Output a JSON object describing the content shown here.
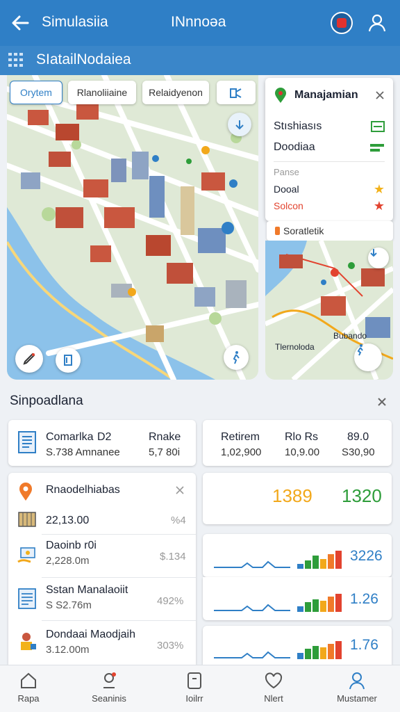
{
  "appbar": {
    "title": "Simulasiia",
    "center_title": "INnnoəa"
  },
  "subbar": {
    "title": "SIatailNodaiea"
  },
  "map_chips": [
    "Orytem",
    "Rlanoliiaine",
    "Relaidyenon"
  ],
  "panel": {
    "title": "Manajamian",
    "items": [
      {
        "label": "Stıshiasıs",
        "icon": "layers-green-icon",
        "color": "#2e9d3a"
      },
      {
        "label": "Doodiaa",
        "icon": "flag-green-icon",
        "color": "#2e9d3a"
      }
    ],
    "section_label": "Panse",
    "items2": [
      {
        "label": "Dooal",
        "icon": "star-yellow-icon",
        "color": "#f2b21b"
      },
      {
        "label": "Solcon",
        "icon": "star-red-icon",
        "color": "#e2432f"
      }
    ]
  },
  "sattag": "Soratletik",
  "map2_labels": [
    "Tlernoloda",
    "Bubando"
  ],
  "section": {
    "title": "Sinpoadlana"
  },
  "stats_card": {
    "l1": "Comarlka",
    "l1b": "D2",
    "l2": "S.738 Amnanee",
    "r1": "Rnake",
    "r2": "5,7 80i"
  },
  "retire_card": {
    "c1a": "Retirem",
    "c1b": "1,02,900",
    "c2a": "Rlo Rs",
    "c2b": "10,9.00",
    "c3a": "89.0",
    "c3b": "S30,90"
  },
  "list_card": {
    "title": "Rnaodelhiabas",
    "rows": [
      {
        "name": "",
        "value": "22,13.00",
        "change": "%4"
      },
      {
        "name": "Daoinb r0i",
        "value": "2,228.0m",
        "change": "$.134"
      },
      {
        "name": "Sstan Manalaoiit",
        "value": "S S2.76m",
        "change": "492%"
      },
      {
        "name": "Dondaai Maodjaih",
        "value": "3.12.00m",
        "change": "303%"
      }
    ]
  },
  "kpi_card": {
    "v1": "1389",
    "v2": "1320",
    "v1_color": "#f2a81b",
    "v2_color": "#2e9d3a"
  },
  "spark_cards": [
    {
      "value": "3226",
      "bars": [
        3,
        5,
        8,
        6,
        9,
        11
      ]
    },
    {
      "value": "1.26",
      "bars": [
        4,
        7,
        9,
        8,
        11,
        13
      ]
    },
    {
      "value": "1.76",
      "bars": [
        5,
        8,
        10,
        9,
        12,
        14
      ]
    }
  ],
  "nav": [
    "Rapa",
    "Seaninis",
    "Ioilrr",
    "Nlert",
    "Mustamer"
  ],
  "colors": {
    "primary": "#2f7fc6",
    "water": "#7fb9e6",
    "road": "#ffffff",
    "park": "#cfe2b6"
  }
}
